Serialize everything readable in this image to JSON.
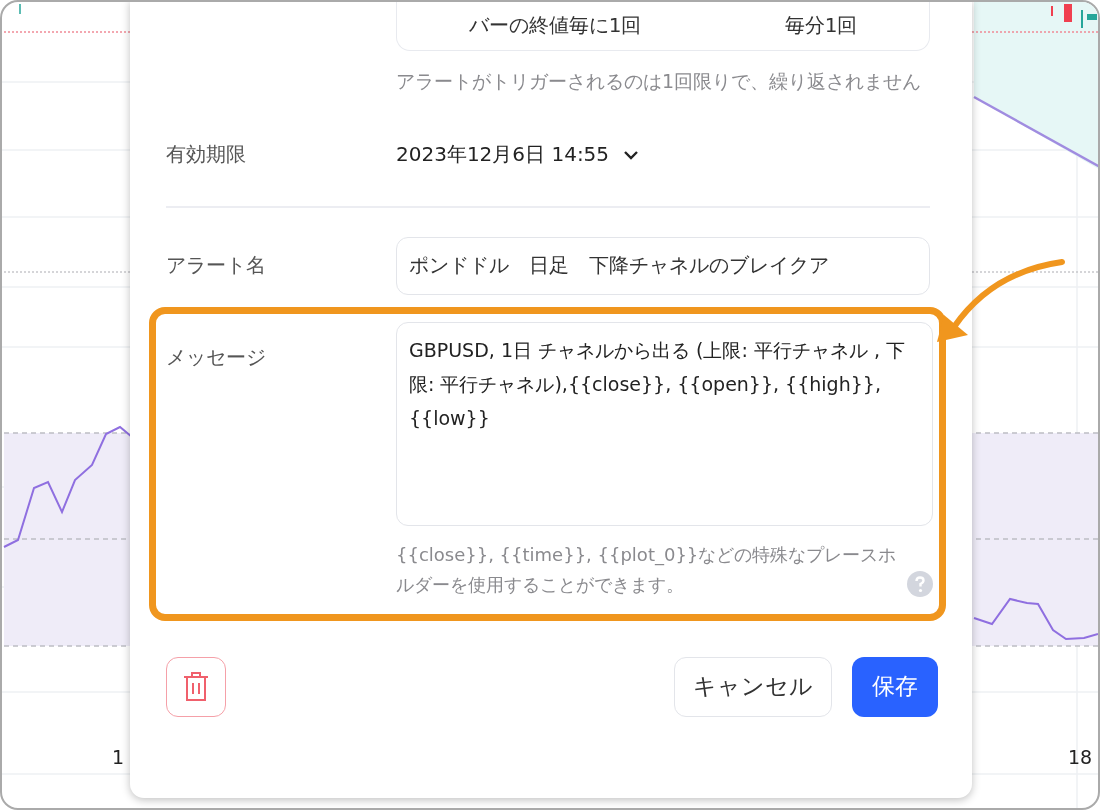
{
  "trigger": {
    "options": [
      {
        "label": "バーの終値毎に1回"
      },
      {
        "label": "毎分1回"
      }
    ],
    "hint": "アラートがトリガーされるのは1回限りで、繰り返されません"
  },
  "expiration": {
    "label": "有効期限",
    "value": "2023年12月6日 14:55"
  },
  "alert_name": {
    "label": "アラート名",
    "value": "ポンドドル　日足　下降チャネルのブレイクア"
  },
  "message": {
    "label": "メッセージ",
    "value": "GBPUSD, 1日 チャネルから出る (上限: 平行チャネル , 下限: 平行チャネル),{{close}}, {{open}}, {{high}}, {{low}}",
    "hint": "{{close}}, {{time}}, {{plot_0}}などの特殊なプレースホルダーを使用することができます。",
    "highlighted": true
  },
  "buttons": {
    "cancel": "キャンセル",
    "save": "保存"
  },
  "chart": {
    "x_labels": [
      "1",
      "18"
    ]
  }
}
